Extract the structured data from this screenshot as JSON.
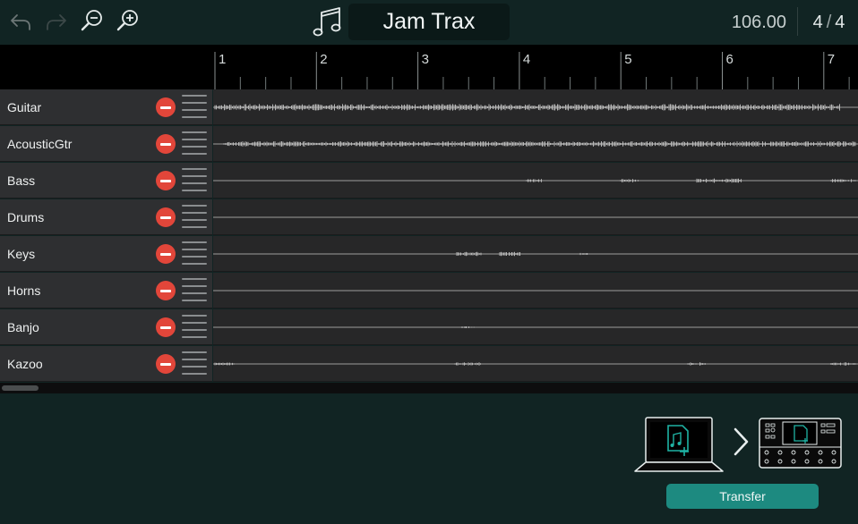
{
  "toolbar": {
    "undo_icon": "undo-arrow-icon",
    "redo_icon": "redo-arrow-icon",
    "zoom_out_icon": "zoom-out-icon",
    "zoom_in_icon": "zoom-in-icon",
    "music_icon": "music-note-icon",
    "song_title": "Jam Trax",
    "tempo": "106.00",
    "time_signature": {
      "numerator": "4",
      "separator": "/",
      "denominator": "4"
    }
  },
  "ruler": {
    "bars": [
      "1",
      "2",
      "3",
      "4",
      "5",
      "6",
      "7"
    ]
  },
  "tracks": [
    {
      "name": "Guitar"
    },
    {
      "name": "AcousticGtr"
    },
    {
      "name": "Bass"
    },
    {
      "name": "Drums"
    },
    {
      "name": "Keys"
    },
    {
      "name": "Horns"
    },
    {
      "name": "Banjo"
    },
    {
      "name": "Kazoo"
    }
  ],
  "bottom": {
    "transfer_label": "Transfer",
    "laptop_icon": "laptop-with-file-icon",
    "arrow_icon": "chevron-right-icon",
    "device_icon": "pedal-device-icon"
  },
  "colors": {
    "background": "#112423",
    "mute": "#e2463a",
    "accent": "#1d8a80",
    "waveform": "#b8b8b8"
  }
}
